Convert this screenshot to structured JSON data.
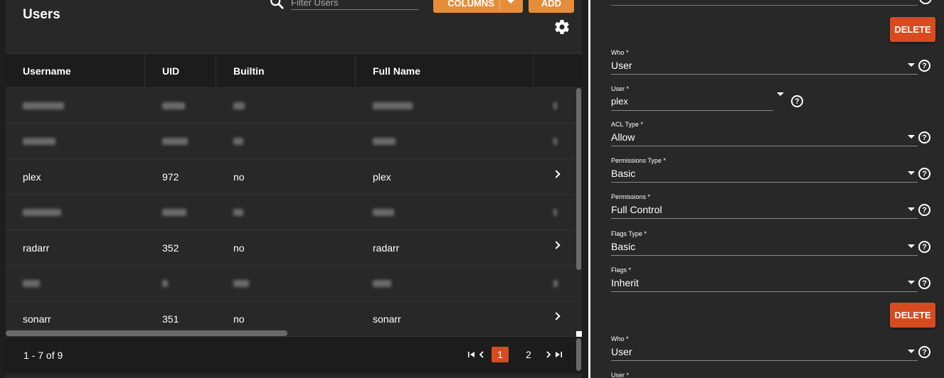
{
  "users_panel": {
    "title": "Users",
    "search": {
      "placeholder": "Filter Users",
      "value": ""
    },
    "columns_label": "COLUMNS",
    "add_label": "ADD",
    "headers": [
      "Username",
      "UID",
      "Builtin",
      "Full Name"
    ],
    "rows": [
      {
        "username": "",
        "uid": "",
        "builtin": "",
        "full_name": "",
        "redacted": true
      },
      {
        "username": "",
        "uid": "",
        "builtin": "",
        "full_name": "",
        "redacted": true
      },
      {
        "username": "plex",
        "uid": "972",
        "builtin": "no",
        "full_name": "plex",
        "redacted": false
      },
      {
        "username": "",
        "uid": "",
        "builtin": "",
        "full_name": "",
        "redacted": true
      },
      {
        "username": "radarr",
        "uid": "352",
        "builtin": "no",
        "full_name": "radarr",
        "redacted": false
      },
      {
        "username": "",
        "uid": "",
        "builtin": "",
        "full_name": "",
        "redacted": true
      },
      {
        "username": "sonarr",
        "uid": "351",
        "builtin": "no",
        "full_name": "sonarr",
        "redacted": false
      }
    ],
    "pagination": {
      "range": "1 - 7 of 9",
      "pages": [
        "1",
        "2"
      ],
      "current_page": "1"
    }
  },
  "acl_panel": {
    "delete_label": "DELETE",
    "entry1": {
      "who": {
        "label": "Who *",
        "value": "User"
      },
      "user": {
        "label": "User *",
        "value": "plex"
      },
      "acl_type": {
        "label": "ACL Type *",
        "value": "Allow"
      },
      "permissions_type": {
        "label": "Permissions Type *",
        "value": "Basic"
      },
      "permissions": {
        "label": "Permissions *",
        "value": "Full Control"
      },
      "flags_type": {
        "label": "Flags Type *",
        "value": "Basic"
      },
      "flags": {
        "label": "Flags *",
        "value": "Inherit"
      }
    },
    "entry2": {
      "who": {
        "label": "Who *",
        "value": "User"
      },
      "user": {
        "label": "User *",
        "value": ""
      }
    }
  },
  "colors": {
    "accent_orange": "#e68d3a",
    "delete_red": "#d84b20",
    "background": "#282828"
  },
  "icons": [
    "search-icon",
    "gear-icon",
    "chevron-right-icon",
    "first-page-icon",
    "prev-page-icon",
    "next-page-icon",
    "last-page-icon",
    "help-icon",
    "dropdown-caret-icon"
  ]
}
